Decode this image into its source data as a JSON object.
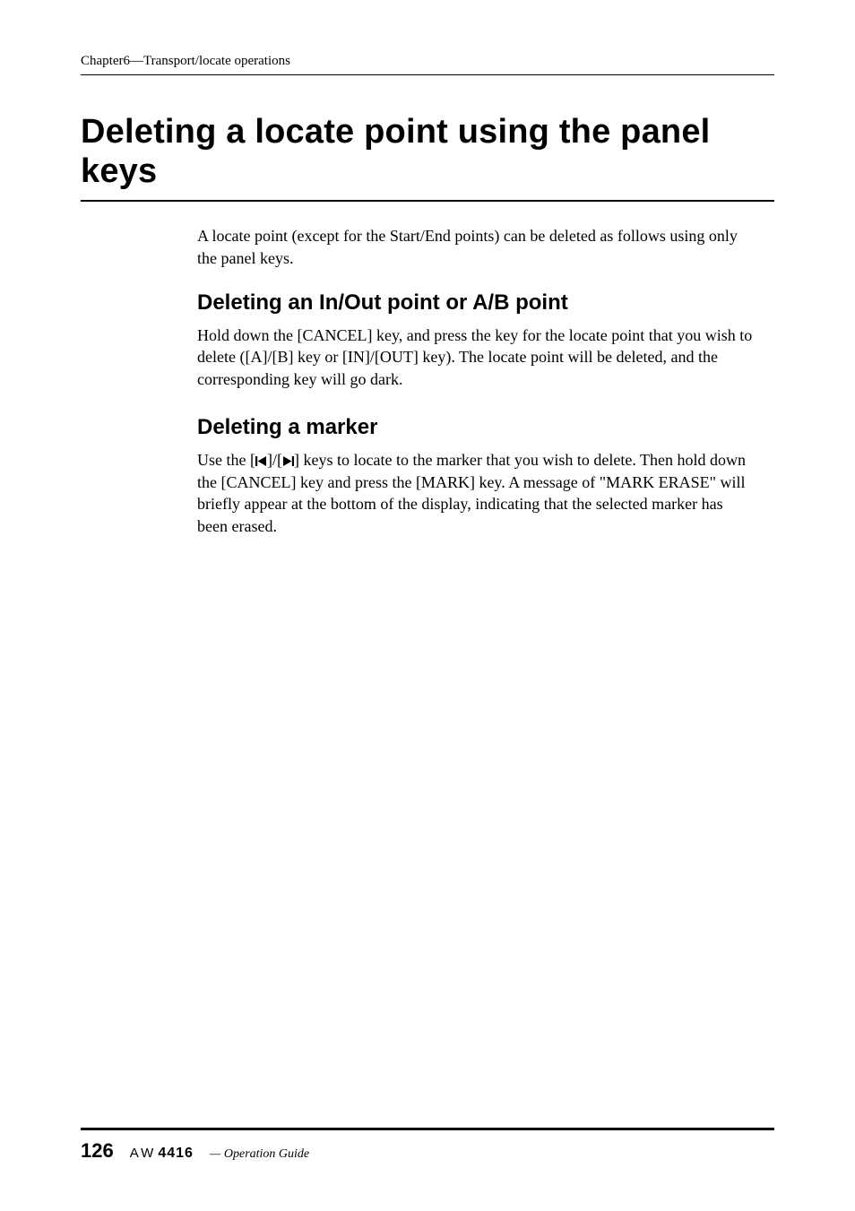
{
  "header": {
    "running": "Chapter6—Transport/locate operations"
  },
  "title": "Deleting a locate point using the panel keys",
  "intro": "A locate point (except for the Start/End points) can be deleted as follows using only the panel keys.",
  "sections": [
    {
      "heading": "Deleting an In/Out point or A/B point",
      "body": "Hold down the [CANCEL] key, and press the key for the locate point that you wish to delete ([A]/[B] key or [IN]/[OUT] key). The locate point will be deleted, and the corresponding key will go dark."
    },
    {
      "heading": "Deleting a marker",
      "body_pre": "Use the [",
      "body_mid": "]/[",
      "body_post": "] keys to locate to the marker that you wish to delete. Then hold down the [CANCEL] key and press the [MARK] key. A message of \"MARK ERASE\" will briefly appear at the bottom of the display, indicating that the selected marker has been erased."
    }
  ],
  "footer": {
    "page_number": "126",
    "model_prefix": "AW",
    "model_number": "4416",
    "guide_label": " — Operation Guide"
  }
}
